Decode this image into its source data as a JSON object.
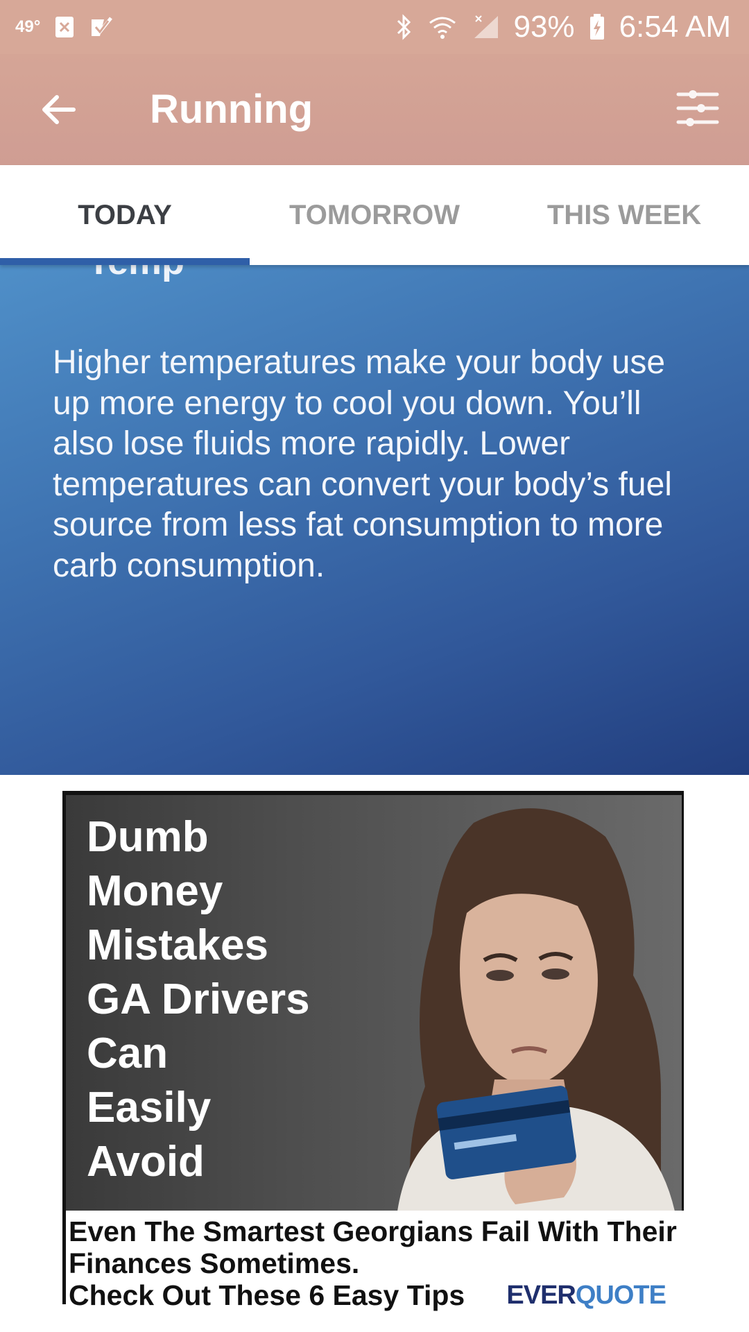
{
  "status_bar": {
    "temperature": "49°",
    "battery_percent": "93%",
    "time": "6:54 AM",
    "icons": [
      "notification-x-icon",
      "checkbox-icon",
      "bluetooth-icon",
      "wifi-icon",
      "cell-signal-icon",
      "battery-charging-icon"
    ]
  },
  "app_bar": {
    "title": "Running",
    "back_icon": "arrow-left-icon",
    "filter_icon": "sliders-icon",
    "background": "#d7a898"
  },
  "tabs": [
    {
      "label": "TODAY",
      "active": true
    },
    {
      "label": "TOMORROW",
      "active": false
    },
    {
      "label": "THIS WEEK",
      "active": false
    }
  ],
  "info_card": {
    "heading": "Temp",
    "body": "Higher temperatures make your body use up more energy to cool you down. You’ll also lose fluids more rapidly. Lower temperatures can convert your body’s fuel source from less fat consumption to more carb consumption."
  },
  "ad": {
    "headline_lines": [
      "Dumb",
      "Money",
      "Mistakes",
      "GA Drivers",
      "Can",
      "Easily",
      "Avoid"
    ],
    "copy_lines": [
      "Even The Smartest Georgians Fail With Their",
      "Finances Sometimes.",
      "Check Out These 6 Easy Tips"
    ],
    "brand_part1": "EVER",
    "brand_part2": "QUOTE"
  },
  "colors": {
    "tab_indicator": "#2f5fa8",
    "card_gradient_top": "#4f8fc8",
    "card_gradient_bottom": "#223e7e"
  }
}
